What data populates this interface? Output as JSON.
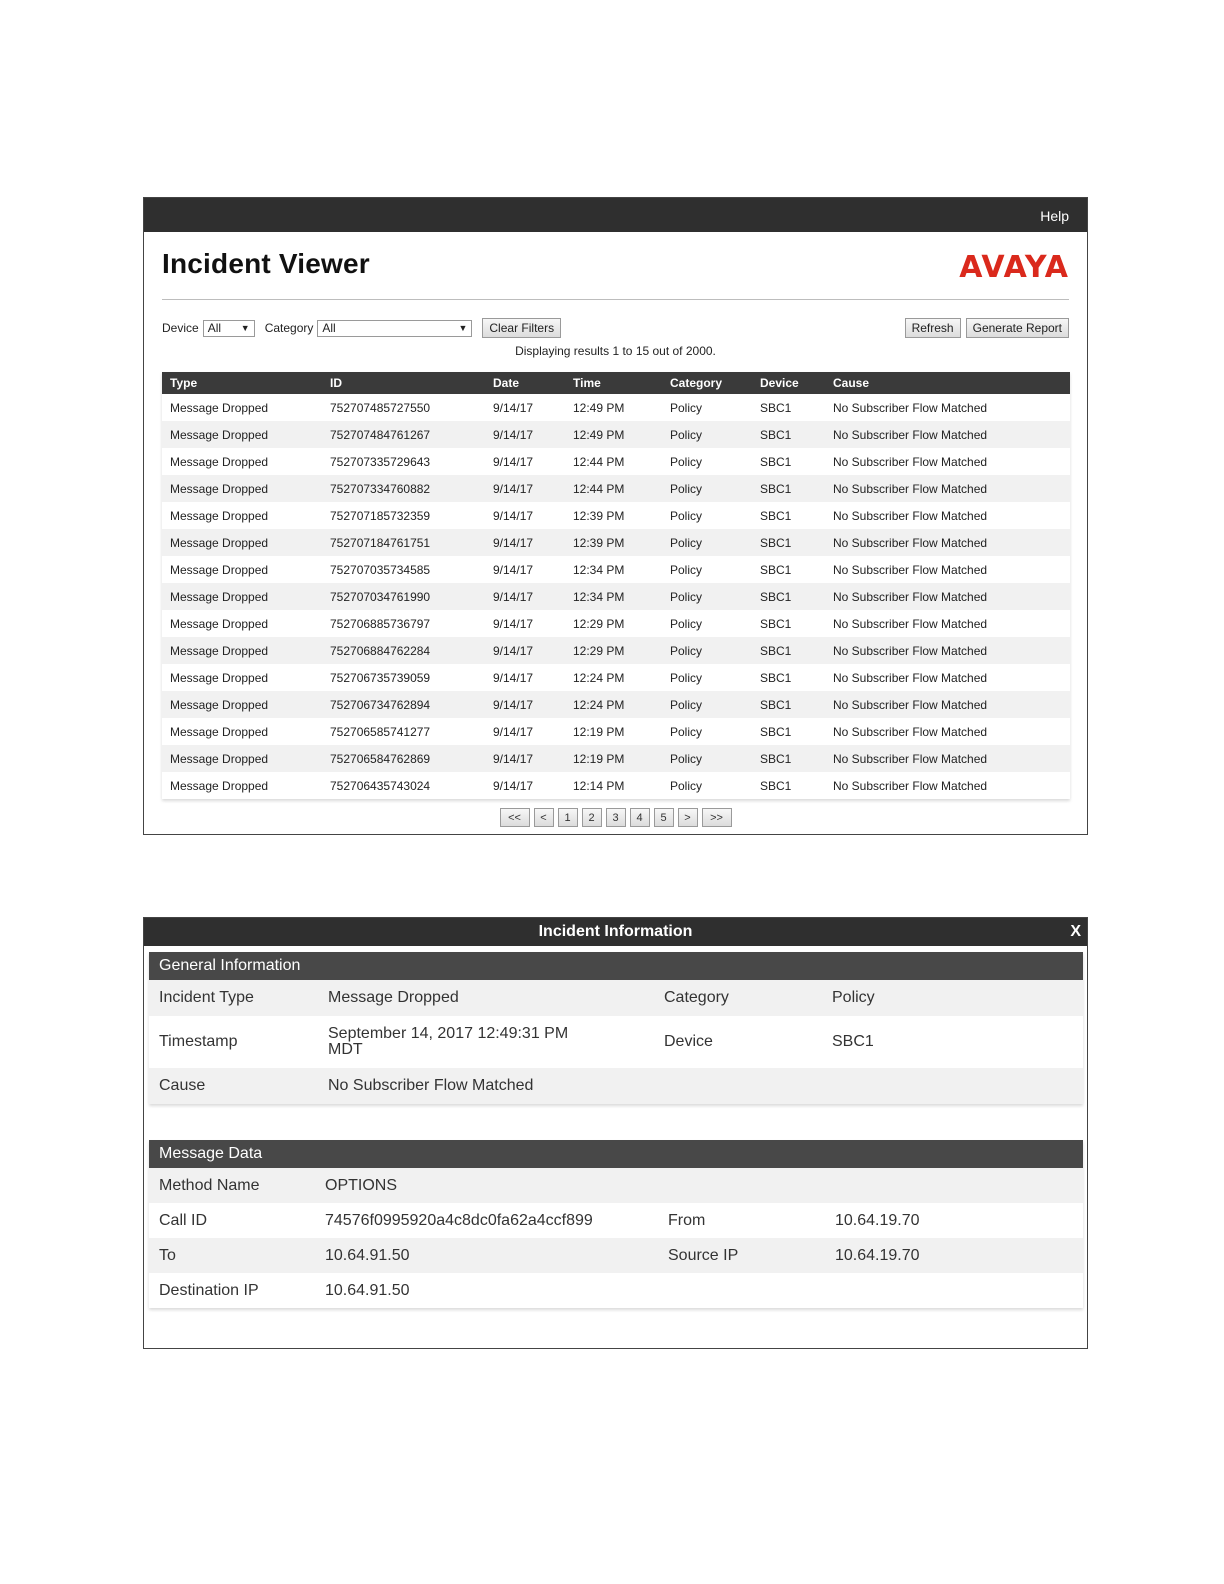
{
  "viewer": {
    "help_label": "Help",
    "title": "Incident Viewer",
    "logo_text": "AVAYA",
    "filters": {
      "device_label": "Device",
      "device_value": "All",
      "category_label": "Category",
      "category_value": "All",
      "clear_label": "Clear Filters"
    },
    "refresh_label": "Refresh",
    "generate_label": "Generate Report",
    "results_text": "Displaying results 1 to 15 out of 2000.",
    "columns": [
      "Type",
      "ID",
      "Date",
      "Time",
      "Category",
      "Device",
      "Cause"
    ],
    "rows": [
      [
        "Message Dropped",
        "752707485727550",
        "9/14/17",
        "12:49 PM",
        "Policy",
        "SBC1",
        "No Subscriber Flow Matched"
      ],
      [
        "Message Dropped",
        "752707484761267",
        "9/14/17",
        "12:49 PM",
        "Policy",
        "SBC1",
        "No Subscriber Flow Matched"
      ],
      [
        "Message Dropped",
        "752707335729643",
        "9/14/17",
        "12:44 PM",
        "Policy",
        "SBC1",
        "No Subscriber Flow Matched"
      ],
      [
        "Message Dropped",
        "752707334760882",
        "9/14/17",
        "12:44 PM",
        "Policy",
        "SBC1",
        "No Subscriber Flow Matched"
      ],
      [
        "Message Dropped",
        "752707185732359",
        "9/14/17",
        "12:39 PM",
        "Policy",
        "SBC1",
        "No Subscriber Flow Matched"
      ],
      [
        "Message Dropped",
        "752707184761751",
        "9/14/17",
        "12:39 PM",
        "Policy",
        "SBC1",
        "No Subscriber Flow Matched"
      ],
      [
        "Message Dropped",
        "752707035734585",
        "9/14/17",
        "12:34 PM",
        "Policy",
        "SBC1",
        "No Subscriber Flow Matched"
      ],
      [
        "Message Dropped",
        "752707034761990",
        "9/14/17",
        "12:34 PM",
        "Policy",
        "SBC1",
        "No Subscriber Flow Matched"
      ],
      [
        "Message Dropped",
        "752706885736797",
        "9/14/17",
        "12:29 PM",
        "Policy",
        "SBC1",
        "No Subscriber Flow Matched"
      ],
      [
        "Message Dropped",
        "752706884762284",
        "9/14/17",
        "12:29 PM",
        "Policy",
        "SBC1",
        "No Subscriber Flow Matched"
      ],
      [
        "Message Dropped",
        "752706735739059",
        "9/14/17",
        "12:24 PM",
        "Policy",
        "SBC1",
        "No Subscriber Flow Matched"
      ],
      [
        "Message Dropped",
        "752706734762894",
        "9/14/17",
        "12:24 PM",
        "Policy",
        "SBC1",
        "No Subscriber Flow Matched"
      ],
      [
        "Message Dropped",
        "752706585741277",
        "9/14/17",
        "12:19 PM",
        "Policy",
        "SBC1",
        "No Subscriber Flow Matched"
      ],
      [
        "Message Dropped",
        "752706584762869",
        "9/14/17",
        "12:19 PM",
        "Policy",
        "SBC1",
        "No Subscriber Flow Matched"
      ],
      [
        "Message Dropped",
        "752706435743024",
        "9/14/17",
        "12:14 PM",
        "Policy",
        "SBC1",
        "No Subscriber Flow Matched"
      ]
    ],
    "pager": [
      "<<",
      "<",
      "1",
      "2",
      "3",
      "4",
      "5",
      ">",
      ">>"
    ]
  },
  "info": {
    "title": "Incident Information",
    "close_label": "X",
    "general": {
      "heading": "General Information",
      "incident_type_label": "Incident Type",
      "incident_type": "Message Dropped",
      "category_label": "Category",
      "category": "Policy",
      "timestamp_label": "Timestamp",
      "timestamp_line1": "September 14, 2017 12:49:31 PM",
      "timestamp_line2": "MDT",
      "device_label": "Device",
      "device": "SBC1",
      "cause_label": "Cause",
      "cause": "No Subscriber Flow Matched"
    },
    "message": {
      "heading": "Message Data",
      "method_label": "Method Name",
      "method": "OPTIONS",
      "call_id_label": "Call ID",
      "call_id": "74576f0995920a4c8dc0fa62a4ccf899",
      "from_label": "From",
      "from": "10.64.19.70",
      "to_label": "To",
      "to": "10.64.91.50",
      "source_ip_label": "Source IP",
      "source_ip": "10.64.19.70",
      "dest_ip_label": "Destination IP",
      "dest_ip": "10.64.91.50"
    }
  },
  "colors": {
    "brand": "#da291c",
    "bar": "#2f2f2f"
  }
}
